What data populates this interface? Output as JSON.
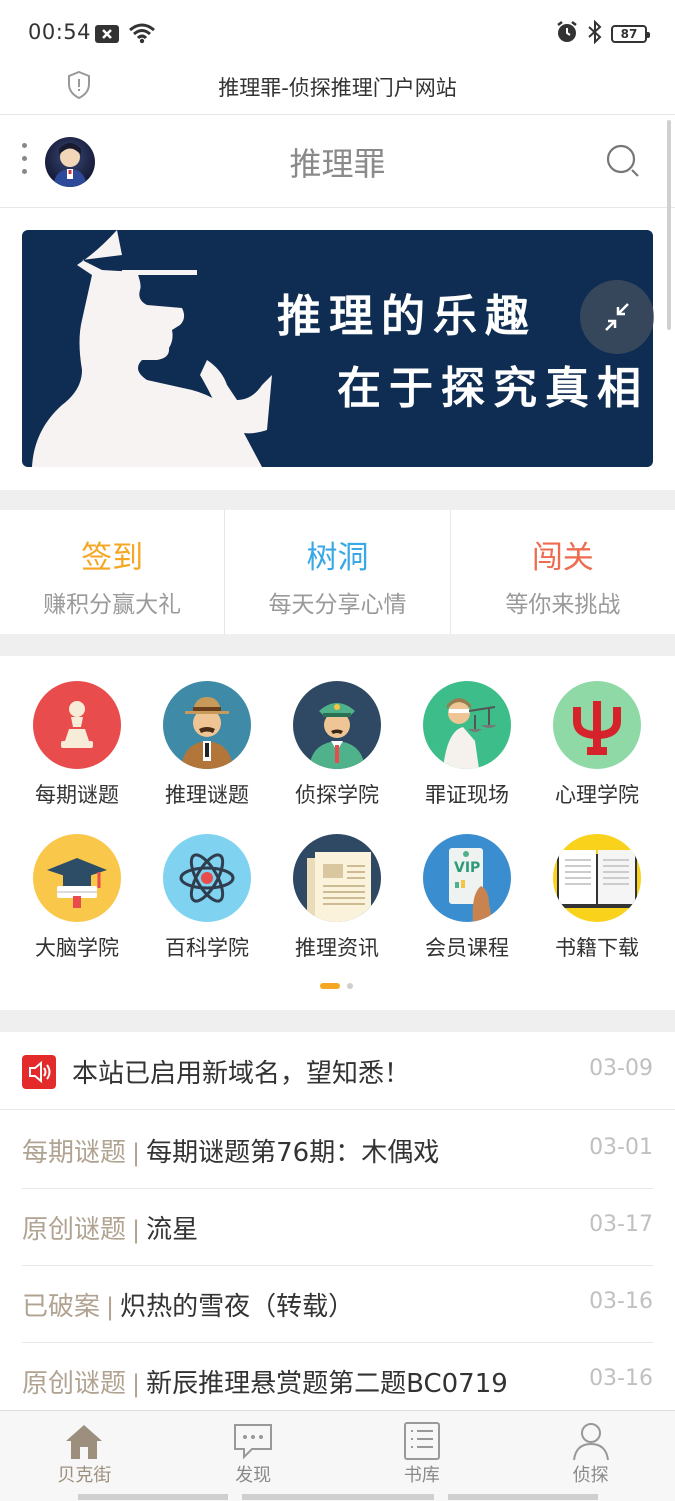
{
  "status_bar": {
    "time": "00:54",
    "battery": "87"
  },
  "browser": {
    "title": "推理罪-侦探推理门户网站"
  },
  "header": {
    "site_name": "推理罪"
  },
  "banner": {
    "line1": "推理的乐趣",
    "line2": "在于探究真相"
  },
  "quick_actions": [
    {
      "title": "签到",
      "subtitle": "赚积分赢大礼",
      "color": "#f5a623"
    },
    {
      "title": "树洞",
      "subtitle": "每天分享心情",
      "color": "#3aa8e6"
    },
    {
      "title": "闯关",
      "subtitle": "等你来挑战",
      "color": "#ef6b4f"
    }
  ],
  "categories": [
    {
      "label": "每期谜题",
      "icon": "chess-pawn-icon"
    },
    {
      "label": "推理谜题",
      "icon": "detective-icon"
    },
    {
      "label": "侦探学院",
      "icon": "officer-icon"
    },
    {
      "label": "罪证现场",
      "icon": "justice-icon"
    },
    {
      "label": "心理学院",
      "icon": "psi-icon"
    },
    {
      "label": "大脑学院",
      "icon": "graduation-cap-icon"
    },
    {
      "label": "百科学院",
      "icon": "atom-icon"
    },
    {
      "label": "推理资讯",
      "icon": "newspaper-icon"
    },
    {
      "label": "会员课程",
      "icon": "vip-card-icon"
    },
    {
      "label": "书籍下载",
      "icon": "book-icon"
    }
  ],
  "announcement": {
    "text": "本站已启用新域名，望知悉！",
    "date": "03-09"
  },
  "news": [
    {
      "category": "每期谜题",
      "separator": "|",
      "title": "每期谜题第76期：木偶戏",
      "date": "03-01"
    },
    {
      "category": "原创谜题",
      "separator": "|",
      "title": "流星",
      "date": "03-17"
    },
    {
      "category": "已破案",
      "separator": "|",
      "title": "炽热的雪夜（转载）",
      "date": "03-16"
    },
    {
      "category": "原创谜题",
      "separator": "|",
      "title": "新辰推理悬赏题第二题BC0719",
      "date": "03-16"
    }
  ],
  "bottom_nav": [
    {
      "label": "贝克街",
      "icon": "house-icon"
    },
    {
      "label": "发现",
      "icon": "chat-bubble-icon"
    },
    {
      "label": "书库",
      "icon": "book-list-icon"
    },
    {
      "label": "侦探",
      "icon": "user-icon"
    }
  ]
}
